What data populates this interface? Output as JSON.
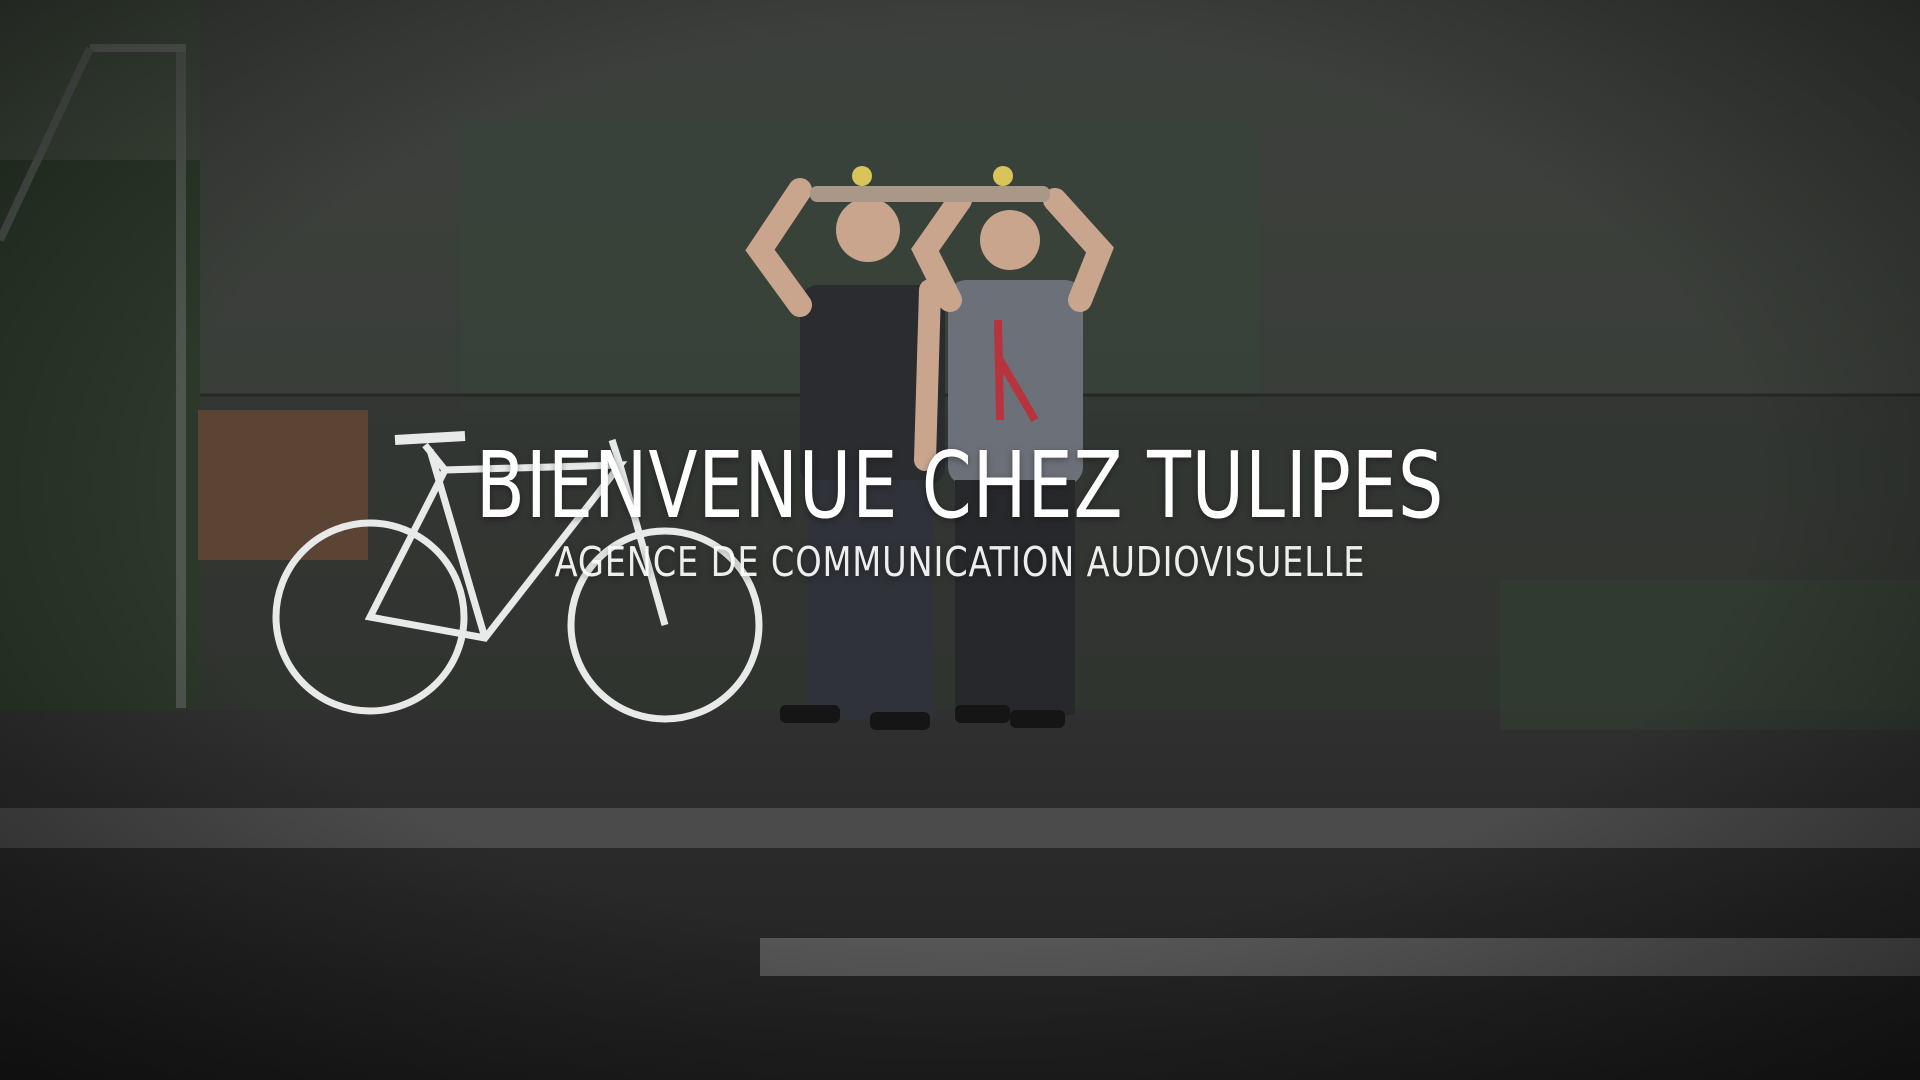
{
  "hero": {
    "title": "BIENVENUE CHEZ TULIPES",
    "subtitle": "AGENCE DE COMMUNICATION AUDIOVISUELLE"
  },
  "colors": {
    "text": "#ffffff",
    "wall": "#3e413d",
    "road": "#242524",
    "foliage": "#2f3d2c"
  }
}
